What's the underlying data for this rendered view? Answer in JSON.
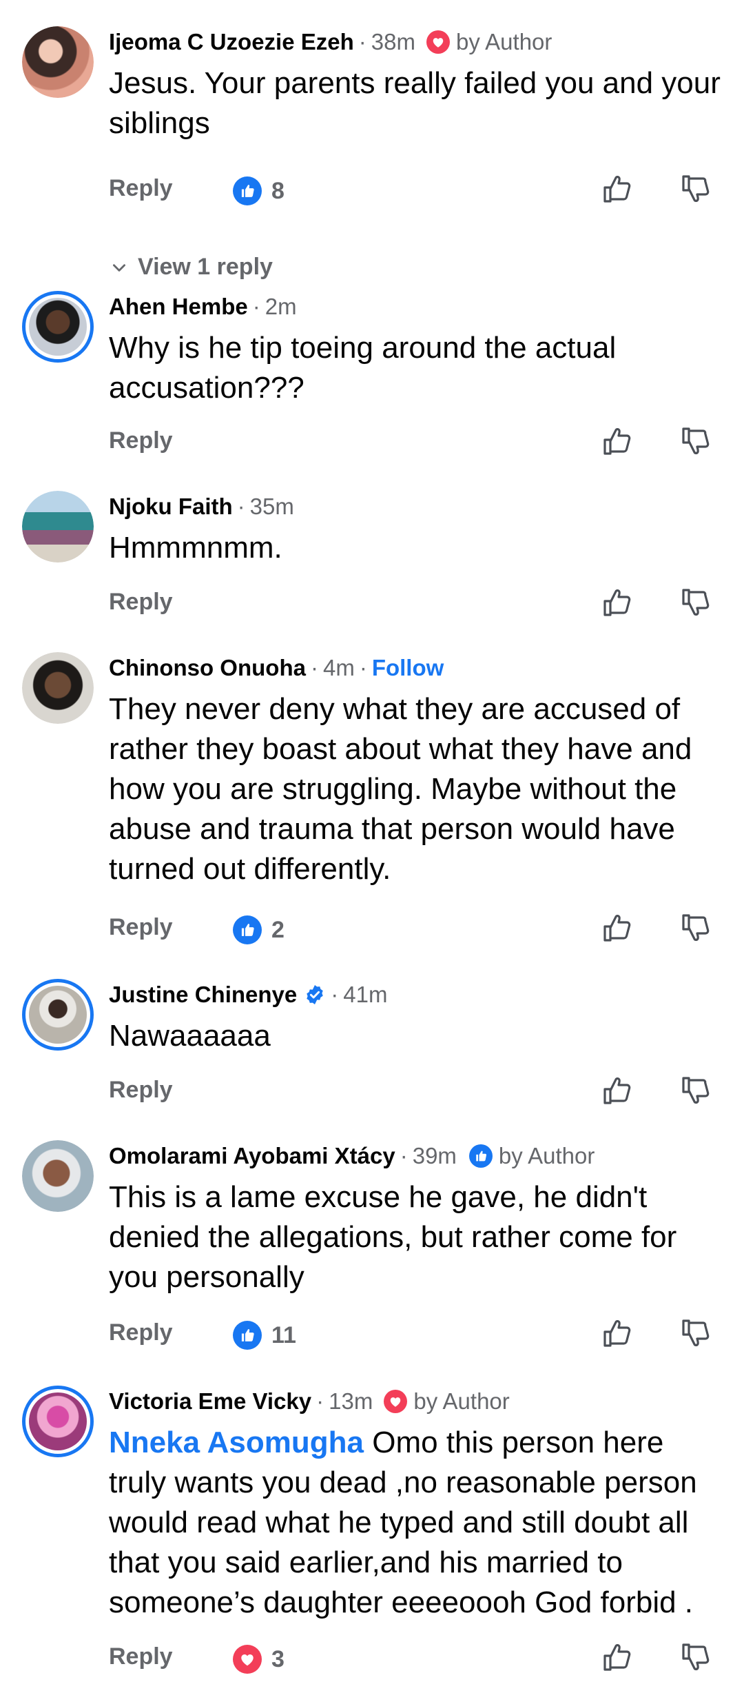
{
  "comments": [
    {
      "author": "Ijeoma C Uzoezie Ezeh",
      "time": "38m",
      "badge_label": "by Author",
      "badge_icon": "heart-icon",
      "text": "Jesus. Your parents really failed you and your siblings",
      "reply_label": "Reply",
      "reaction_icon": "like-icon",
      "reaction_count": "8",
      "view_replies": "View 1 reply"
    },
    {
      "author": "Ahen Hembe",
      "time": "2m",
      "text": "Why is he tip toeing around the actual accusation???",
      "reply_label": "Reply"
    },
    {
      "author": "Njoku Faith",
      "time": "35m",
      "text": "Hmmmnmm.",
      "reply_label": "Reply"
    },
    {
      "author": "Chinonso Onuoha",
      "time": "4m",
      "follow_label": "Follow",
      "text": "They never deny what they are accused of rather they boast about what they have and how you are struggling. Maybe without the abuse and trauma that person would have turned out differently.",
      "reply_label": "Reply",
      "reaction_icon": "like-icon",
      "reaction_count": "2"
    },
    {
      "author": "Justine Chinenye",
      "verified": true,
      "time": "41m",
      "text": "Nawaaaaaa",
      "reply_label": "Reply"
    },
    {
      "author": "Omolarami Ayobami Xtácy",
      "time": "39m",
      "badge_label": "by Author",
      "badge_icon": "like-icon",
      "text": "This is a lame excuse he gave, he didn't denied the allegations, but rather come for you personally",
      "reply_label": "Reply",
      "reaction_icon": "like-icon",
      "reaction_count": "11"
    },
    {
      "author": "Victoria Eme Vicky",
      "time": "13m",
      "badge_label": "by Author",
      "badge_icon": "heart-icon",
      "mention": "Nneka Asomugha",
      "text": "Omo this person here truly wants you dead ,no reasonable person would read what he typed and still doubt all that you said earlier,and his married to someone’s daughter eeeeoooh God forbid .",
      "reply_label": "Reply",
      "reaction_icon": "heart-icon",
      "reaction_count": "3"
    }
  ],
  "colors": {
    "link_blue": "#1877f2",
    "love_red": "#f33e58",
    "meta_gray": "#65676b",
    "text_black": "#050505"
  }
}
